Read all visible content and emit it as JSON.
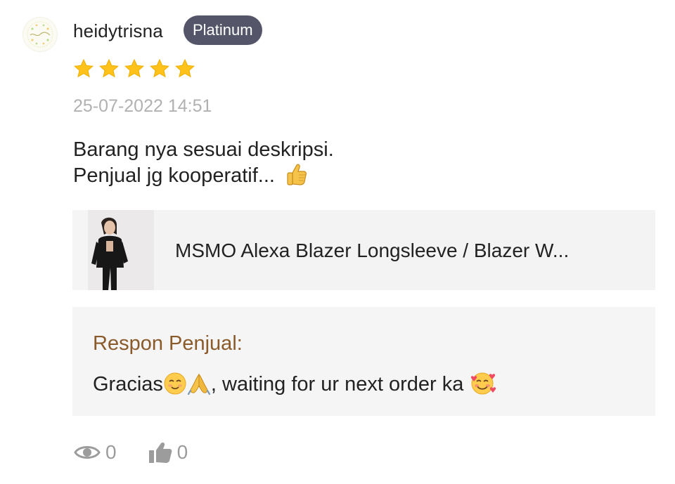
{
  "review": {
    "username": "heidytrisna",
    "badge": "Platinum",
    "rating": 5,
    "rating_max": 5,
    "timestamp": "25-07-2022 14:51",
    "text_line1": "Barang nya sesuai deskripsi.",
    "text_line2": "Penjual jg kooperatif..."
  },
  "product": {
    "title": "MSMO Alexa Blazer Longsleeve / Blazer W..."
  },
  "seller_response": {
    "label": "Respon Penjual:",
    "text_part1": "Gracias",
    "text_part2": ", waiting for ur next order ka"
  },
  "stats": {
    "views": "0",
    "likes": "0"
  },
  "icons": {
    "star": "star-icon",
    "view": "eye-icon",
    "like": "thumbs-up-icon",
    "review_emoji": "thumbs-up-emoji",
    "response_emojis": [
      "relieved-face-emoji",
      "folded-hands-emoji",
      "smiling-face-with-hearts-emoji"
    ]
  },
  "colors": {
    "badge_bg": "#55556a",
    "star": "#ffc21a",
    "seller_label": "#8a5a2b",
    "muted": "#b1b1b1"
  }
}
